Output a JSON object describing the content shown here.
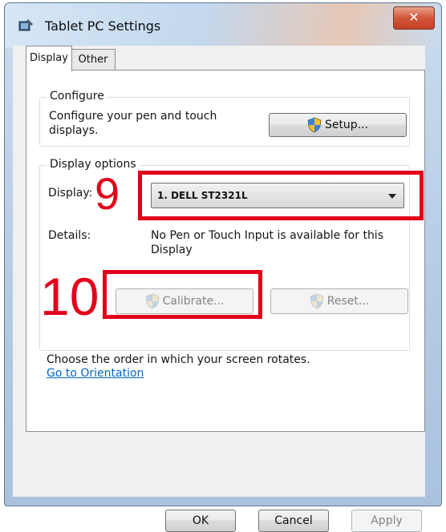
{
  "window": {
    "title": "Tablet PC Settings",
    "close_label": "✕"
  },
  "tabs": [
    {
      "label": "Display",
      "active": true
    },
    {
      "label": "Other",
      "active": false
    }
  ],
  "configure": {
    "group_title": "Configure",
    "text": "Configure your pen and touch displays.",
    "setup_button": "Setup..."
  },
  "display_options": {
    "group_title": "Display options",
    "display_label": "Display:",
    "display_selected": "1. DELL ST2321L",
    "details_label": "Details:",
    "details_value": "No Pen or Touch Input is available for this Display",
    "calibrate_button": "Calibrate...",
    "reset_button": "Reset..."
  },
  "orientation": {
    "text": "Choose the order in which your screen rotates.",
    "link": "Go to Orientation"
  },
  "buttons": {
    "ok": "OK",
    "cancel": "Cancel",
    "apply": "Apply"
  },
  "annotations": {
    "nine": "9",
    "ten": "10"
  },
  "colors": {
    "annotation_red": "#e2001a",
    "link_blue": "#0066cc"
  }
}
